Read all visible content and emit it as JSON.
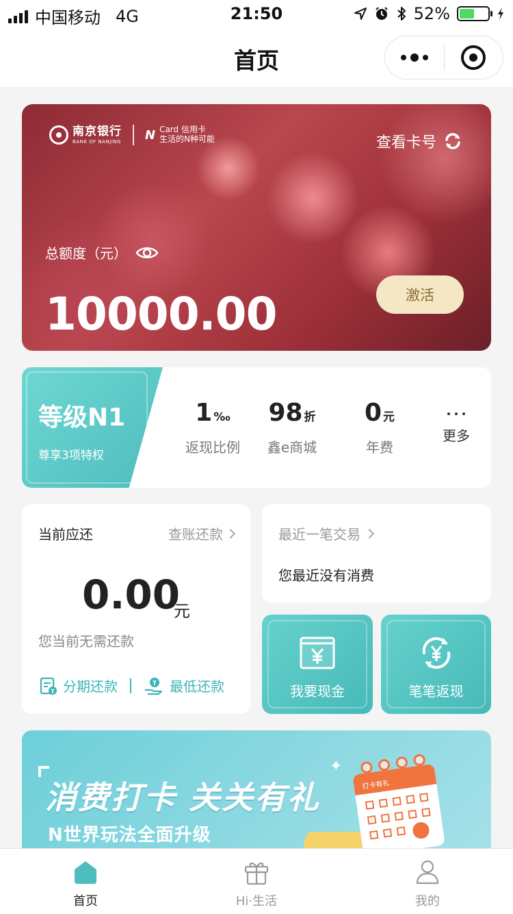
{
  "status_bar": {
    "carrier": "中国移动",
    "network": "4G",
    "time": "21:50",
    "battery": "52%",
    "battery_level": 0.52
  },
  "nav": {
    "title": "首页"
  },
  "card": {
    "bank_name": "南京银行",
    "bank_name_en": "BANK OF NANJING",
    "brand_mark": "N",
    "brand_line1": "Card 信用卡",
    "brand_line2": "生活的N种可能",
    "view_number": "查看卡号",
    "limit_label": "总额度（元）",
    "limit_amount": "10000.00",
    "activate": "激活"
  },
  "level": {
    "title": "等级N1",
    "subtitle": "尊享3项特权",
    "benefits": [
      {
        "value": "1",
        "unit": "‰",
        "label": "返现比例"
      },
      {
        "value": "98",
        "unit": "折",
        "label": "鑫e商城"
      },
      {
        "value": "0",
        "unit": "元",
        "label": "年费"
      }
    ],
    "more": "更多"
  },
  "repay": {
    "title": "当前应还",
    "link": "查账还款",
    "amount": "0.00",
    "unit": "元",
    "status": "您当前无需还款",
    "installment": "分期还款",
    "minimum": "最低还款"
  },
  "recent": {
    "title": "最近一笔交易",
    "text": "您最近没有消费"
  },
  "tiles": {
    "cash": "我要现金",
    "cashback": "笔笔返现"
  },
  "banner": {
    "title": "消费打卡 关关有礼",
    "subtitle": "N世界玩法全面升级",
    "calendar_label": "打卡有礼"
  },
  "tab_bar": {
    "home": "首页",
    "life": "Hi·生活",
    "me": "我的"
  },
  "colors": {
    "accent_teal": "#4ebdbe",
    "activate_bg": "#f6e7c4",
    "battery_green": "#4cd964"
  }
}
